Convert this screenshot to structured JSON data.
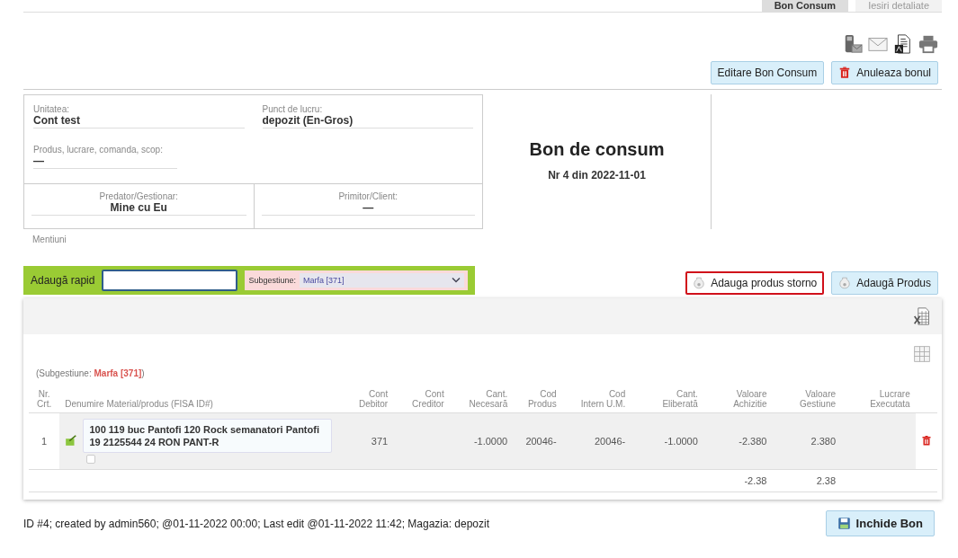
{
  "tabs": [
    {
      "label": "Bon Consum",
      "selected": true
    },
    {
      "label": "Iesiri detaliate",
      "selected": false
    }
  ],
  "header_buttons": [
    {
      "label": "Editare Bon Consum",
      "kind": "plain"
    },
    {
      "label": "Anuleaza bonul",
      "kind": "delete"
    }
  ],
  "document": {
    "fields": [
      {
        "label": "Unitatea:",
        "value": "Cont test"
      },
      {
        "label": "Punct de lucru:",
        "value": "depozit (En-Gros)"
      },
      {
        "label": "Produs, lucrare, comanda, scop:",
        "value": "—"
      }
    ],
    "parties": [
      {
        "label": "Predator/Gestionar:",
        "value": "Mine cu Eu"
      },
      {
        "label": "Primitor/Client:",
        "value": "—"
      }
    ],
    "title": "Bon de consum",
    "subtitle": "Nr 4 din 2022-11-01"
  },
  "mentions_label": "Mentiuni",
  "quick_add": {
    "label": "Adaugă rapid",
    "subgestiune_label": "Subgestiune:",
    "subgestiune_value": "Marfa [371]"
  },
  "product_buttons": [
    {
      "label": "Adauga produs storno",
      "highlighted": true
    },
    {
      "label": "Adaugă Produs",
      "highlighted": false
    }
  ],
  "table": {
    "note": "(Subgestiune: **Marfa [371]**)",
    "columns": [
      "Nr.\nCrt.",
      "Denumire Material/produs (FISA ID#)",
      "Cont\nDebitor",
      "Cont\nCreditor",
      "Cant.\nNecesară",
      "Cod\nProdus",
      "Cod\nIntern U.M.",
      "Cant.\nEliberată",
      "Valoare\nAchizitie",
      "Valoare\nGestiune",
      "Lucrare\nExecutata"
    ],
    "rows": [
      {
        "checked": false,
        "cells": [
          "1",
          "100 119 buc Pantofi 120 Rock semanatori Pantofi 19 2125544 24 RON PANT-R",
          "371",
          "",
          "-1.0000",
          "20046-",
          "20046-",
          "-1.0000",
          "-2.380",
          "2.380",
          ""
        ]
      }
    ],
    "totals": {
      "acquisition": "-2.38",
      "stock_value": "2.38"
    }
  },
  "footer": "ID #4; created by admin560; @01-11-2022 00:00; Last edit @01-11-2022 11:42; Magazia: depozit",
  "close_button": "Inchide Bon"
}
